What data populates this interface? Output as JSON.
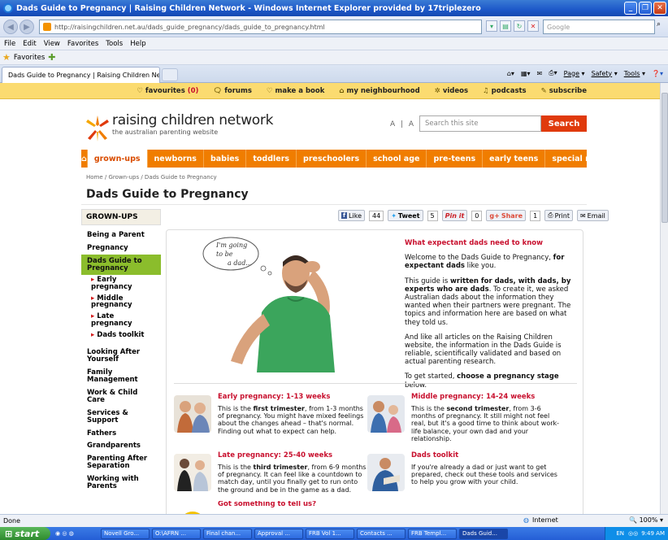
{
  "window": {
    "title": "Dads Guide to Pregnancy | Raising Children Network - Windows Internet Explorer provided by 17triplezero"
  },
  "address": {
    "url": "http://raisingchildren.net.au/dads_guide_pregnancy/dads_guide_to_pregnancy.html",
    "search_placeholder": "Google"
  },
  "menu": [
    "File",
    "Edit",
    "View",
    "Favorites",
    "Tools",
    "Help"
  ],
  "favorites_bar": {
    "label": "Favorites"
  },
  "tab": {
    "label": "Dads Guide to Pregnancy | Raising Children Network"
  },
  "commandbar": {
    "page": "Page",
    "safety": "Safety",
    "tools": "Tools"
  },
  "site_top": {
    "favourites": "favourites",
    "favourites_count": "(0)",
    "forums": "forums",
    "make_a_book": "make a book",
    "my_neighbourhood": "my neighbourhood",
    "videos": "videos",
    "podcasts": "podcasts",
    "subscribe": "subscribe"
  },
  "logo": {
    "name": "raising children network",
    "tagline": "the australian parenting website"
  },
  "text_size": "A | A",
  "site_search": {
    "placeholder": "Search this site",
    "button": "Search"
  },
  "nav": [
    "grown-ups",
    "newborns",
    "babies",
    "toddlers",
    "preschoolers",
    "school age",
    "pre-teens",
    "early teens",
    "special needs"
  ],
  "breadcrumb": "Home / Grown-ups / Dads Guide to Pregnancy",
  "page_title": "Dads Guide to Pregnancy",
  "sidebar": {
    "heading": "GROWN-UPS",
    "items_top": [
      "Being a Parent",
      "Pregnancy"
    ],
    "active": "Dads Guide to Pregnancy",
    "subitems": [
      "Early pregnancy",
      "Middle pregnancy",
      "Late pregnancy",
      "Dads toolkit"
    ],
    "items_bottom": [
      "Looking After Yourself",
      "Family Management",
      "Work & Child Care",
      "Services & Support",
      "Fathers",
      "Grandparents",
      "Parenting After Separation",
      "Working with Parents"
    ]
  },
  "share": {
    "like": "Like",
    "like_count": "44",
    "tweet": "Tweet",
    "tweet_count": "5",
    "pin": "Pin it",
    "pin_count": "0",
    "share": "Share",
    "share_count": "1",
    "print": "Print",
    "email": "Email"
  },
  "hero": {
    "bubble": "I'm going to be a dad..."
  },
  "intro": {
    "heading": "What expectant dads need to know",
    "p1_a": "Welcome to the Dads Guide to Pregnancy, ",
    "p1_b": "for expectant dads",
    "p1_c": " like you.",
    "p2_a": "This guide is ",
    "p2_b": "written for dads, with dads, by experts who are dads",
    "p2_c": ". To create it, we asked Australian dads about the information they wanted when their partners were pregnant. The topics and information here are based on what they told us.",
    "p3": "And like all articles on the Raising Children website, the information in the Dads Guide is reliable, scientifically validated and based on actual parenting research.",
    "p4_a": "To get started, ",
    "p4_b": "choose a pregnancy stage",
    "p4_c": " below."
  },
  "cards": [
    {
      "title": "Early pregnancy: 1-13 weeks",
      "a": "This is the ",
      "b": "first trimester",
      "c": ", from 1-3 months of pregnancy. You might have mixed feelings about the changes ahead – that's normal. Finding out what to expect can help."
    },
    {
      "title": "Middle pregnancy: 14-24 weeks",
      "a": "This is the ",
      "b": "second trimester",
      "c": ", from 3-6 months of pregnancy. It still might not feel real, but it's a good time to think about work-life balance, your own dad and your relationship."
    },
    {
      "title": "Late pregnancy: 25-40 weeks",
      "a": "This is the ",
      "b": "third trimester",
      "c": ", from 6-9 months of pregnancy. It can feel like a countdown to match day, until you finally get to run onto the ground and be in the game as a dad."
    },
    {
      "title": "Dads toolkit",
      "a": "",
      "b": "",
      "c": "If you're already a dad or just want to get prepared, check out these tools and services to help you grow with your child."
    },
    {
      "title": "Got something to tell us?",
      "a": "",
      "b": "",
      "c": ""
    }
  ],
  "status": {
    "text": "Done",
    "zone": "Internet",
    "zoom": "100%"
  },
  "taskbar": {
    "start": "start",
    "buttons": [
      "Novell Gro...",
      "O:\\AFRN ...",
      "Final chan...",
      "Approval ...",
      "FRB Vol 1...",
      "Contacts ...",
      "FRB Templ...",
      "Dads Guid..."
    ],
    "lang": "EN",
    "clock": "9:49 AM"
  }
}
